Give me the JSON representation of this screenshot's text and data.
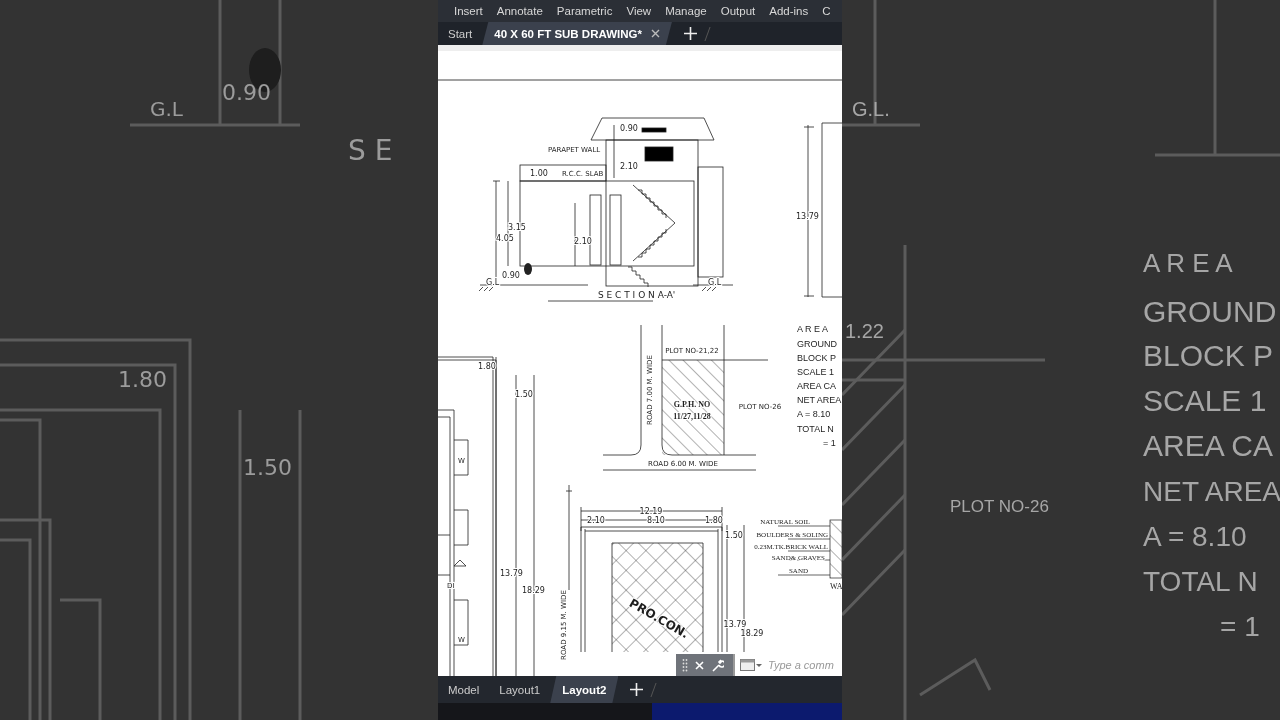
{
  "backdrop": {
    "left_labels": [
      "0.90",
      "G.L",
      "S E",
      "1.80",
      "1.50"
    ],
    "right_labels": [
      "G.L.",
      "1.22",
      "A R E A",
      "GROUND",
      "BLOCK P",
      "SCALE 1",
      "AREA CA",
      "NET AREA",
      "A = 8.10",
      "TOTAL N",
      "= 1",
      "PLOT NO-26"
    ]
  },
  "ribbon_tabs": [
    {
      "label": "Insert"
    },
    {
      "label": "Annotate"
    },
    {
      "label": "Parametric"
    },
    {
      "label": "View"
    },
    {
      "label": "Manage"
    },
    {
      "label": "Output"
    },
    {
      "label": "Add-ins"
    },
    {
      "label": "C"
    }
  ],
  "file_tabs": [
    {
      "label": "Start",
      "selected": false
    },
    {
      "label": "40 X 60 FT SUB DRAWING*",
      "selected": true
    }
  ],
  "drawing": {
    "section_labels": [
      "0.90",
      "PARAPET WALL",
      "2.10",
      "1.00",
      "R.C.C. SLAB",
      "3.15",
      "4.05",
      "2.10",
      "0.90",
      "G.L",
      "G.L",
      "S E C T I O N  A-A'",
      "13.79"
    ],
    "site_plan_labels": [
      "PLOT NO-21,22",
      "ROAD 7.00 M. WIDE",
      "G.P.H. NO",
      "PLOT NO-26",
      "11/27,11/28",
      "ROAD 6.00 M. WIDE"
    ],
    "area_labels": [
      "A R E A",
      "GROUND",
      "BLOCK P",
      "SCALE 1",
      "AREA CA",
      "NET AREA",
      "A = 8.10",
      "TOTAL N",
      "= 1"
    ],
    "floor_plan_labels": [
      "1.80",
      "1.50",
      "13.79",
      "18.29",
      "W",
      "DI",
      "W"
    ],
    "layout_plan_labels": [
      "12.19",
      "2.10",
      "8.10",
      "1.80",
      "1.50",
      "ROAD 9.15 M. WIDE",
      "PRO.CON.",
      "13.79",
      "18.29"
    ],
    "detail_labels": [
      "NATURAL SOIL",
      "BOULDERS & SOLING",
      "0.23M.TK.BRICK WALL",
      "SAND& GRAVES",
      "SAND",
      "WA"
    ]
  },
  "command_line": {
    "placeholder": "Type a comm"
  },
  "layout_tabs": [
    {
      "label": "Model",
      "selected": false
    },
    {
      "label": "Layout1",
      "selected": false
    },
    {
      "label": "Layout2",
      "selected": true
    }
  ]
}
